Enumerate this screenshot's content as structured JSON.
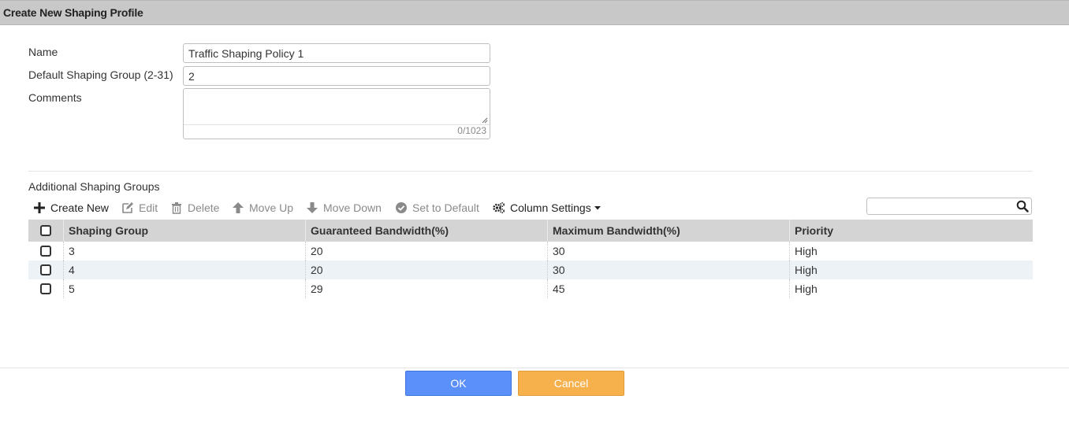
{
  "window": {
    "title": "Create New Shaping Profile"
  },
  "form": {
    "name_label": "Name",
    "name_value": "Traffic Shaping Policy 1",
    "default_group_label": "Default Shaping Group (2-31)",
    "default_group_value": "2",
    "comments_label": "Comments",
    "comments_value": "",
    "comments_counter": "0/1023"
  },
  "section": {
    "title": "Additional Shaping Groups"
  },
  "toolbar": {
    "create_new": "Create New",
    "edit": "Edit",
    "delete": "Delete",
    "move_up": "Move Up",
    "move_down": "Move Down",
    "set_default": "Set to Default",
    "column_settings": "Column Settings",
    "search_value": ""
  },
  "table": {
    "columns": [
      "Shaping Group",
      "Guaranteed Bandwidth(%)",
      "Maximum Bandwidth(%)",
      "Priority"
    ],
    "rows": [
      [
        "3",
        "20",
        "30",
        "High"
      ],
      [
        "4",
        "20",
        "30",
        "High"
      ],
      [
        "5",
        "29",
        "45",
        "High"
      ]
    ]
  },
  "buttons": {
    "ok": "OK",
    "cancel": "Cancel"
  },
  "colors": {
    "ok": "#5b8ff9",
    "cancel": "#f6b04c",
    "titlebar": "#c8c8c8",
    "header": "#d4d4d4",
    "row_alt": "#edf2f7"
  },
  "icons": [
    "plus-icon",
    "edit-icon",
    "trash-icon",
    "arrow-up-icon",
    "arrow-down-icon",
    "check-circle-icon",
    "gears-icon",
    "caret-down-icon",
    "search-icon"
  ]
}
